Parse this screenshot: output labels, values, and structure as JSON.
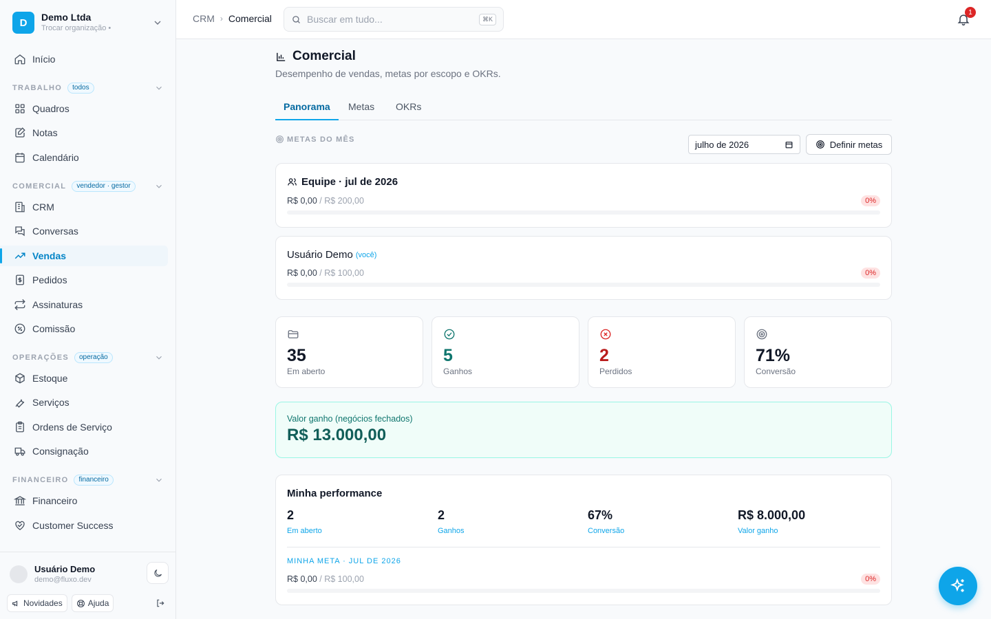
{
  "org": {
    "initial": "D",
    "name": "Demo Ltda",
    "switch_label": "Trocar organização •"
  },
  "nav": {
    "home": "Início",
    "work_section": {
      "title": "TRABALHO",
      "badge": "todos"
    },
    "boards": "Quadros",
    "notes": "Notas",
    "calendar": "Calendário",
    "commercial_section": {
      "title": "COMERCIAL",
      "badge": "vendedor · gestor"
    },
    "crm": "CRM",
    "conversations": "Conversas",
    "sales": "Vendas",
    "orders": "Pedidos",
    "subscriptions": "Assinaturas",
    "commission": "Comissão",
    "operations_section": {
      "title": "OPERAÇÕES",
      "badge": "operação"
    },
    "stock": "Estoque",
    "services": "Serviços",
    "service_orders": "Ordens de Serviço",
    "consignment": "Consignação",
    "finance_section": {
      "title": "FINANCEIRO",
      "badge": "financeiro"
    },
    "finance": "Financeiro",
    "customer_success": "Customer Success"
  },
  "user": {
    "name": "Usuário Demo",
    "email": "demo@fluxo.dev"
  },
  "footer": {
    "news": "Novidades",
    "help": "Ajuda"
  },
  "topbar": {
    "crumb_root": "CRM",
    "crumb_current": "Comercial",
    "search_placeholder": "Buscar em tudo...",
    "search_shortcut": "⌘K",
    "notifications_count": "1"
  },
  "page": {
    "title": "Comercial",
    "subtitle": "Desempenho de vendas, metas por escopo e OKRs.",
    "tabs": [
      "Panorama",
      "Metas",
      "OKRs"
    ],
    "active_tab": "Panorama"
  },
  "goals": {
    "section_title": "METAS DO MÊS",
    "month_value": "julho de 2026",
    "define_button": "Definir metas",
    "team": {
      "title": "Equipe · jul de 2026",
      "achieved": "R$ 0,00",
      "target": "/ R$ 200,00",
      "percent": "0%",
      "progress": 0
    },
    "user": {
      "title": "Usuário Demo",
      "you": "(você)",
      "achieved": "R$ 0,00",
      "target": "/ R$ 100,00",
      "percent": "0%",
      "progress": 0
    }
  },
  "stats": [
    {
      "value": "35",
      "label": "Em aberto",
      "color": "#111827",
      "icon": "folder-icon"
    },
    {
      "value": "5",
      "label": "Ganhos",
      "color": "#0f766e",
      "icon": "check-circle-icon"
    },
    {
      "value": "2",
      "label": "Perdidos",
      "color": "#b91c1c",
      "icon": "x-circle-icon"
    },
    {
      "value": "71%",
      "label": "Conversão",
      "color": "#111827",
      "icon": "target-icon"
    }
  ],
  "won_value": {
    "label": "Valor ganho (negócios fechados)",
    "value": "R$ 13.000,00"
  },
  "performance": {
    "title": "Minha performance",
    "metrics": [
      {
        "value": "2",
        "label": "Em aberto"
      },
      {
        "value": "2",
        "label": "Ganhos"
      },
      {
        "value": "67%",
        "label": "Conversão"
      },
      {
        "value": "R$ 8.000,00",
        "label": "Valor ganho"
      }
    ],
    "goal_title": "MINHA META · JUL DE 2026",
    "goal_achieved": "R$ 0,00",
    "goal_target": "/ R$ 100,00",
    "goal_percent": "0%",
    "goal_progress": 0
  },
  "colors": {
    "accent": "#0ea5e9",
    "danger": "#dc2626",
    "success": "#0f766e"
  }
}
